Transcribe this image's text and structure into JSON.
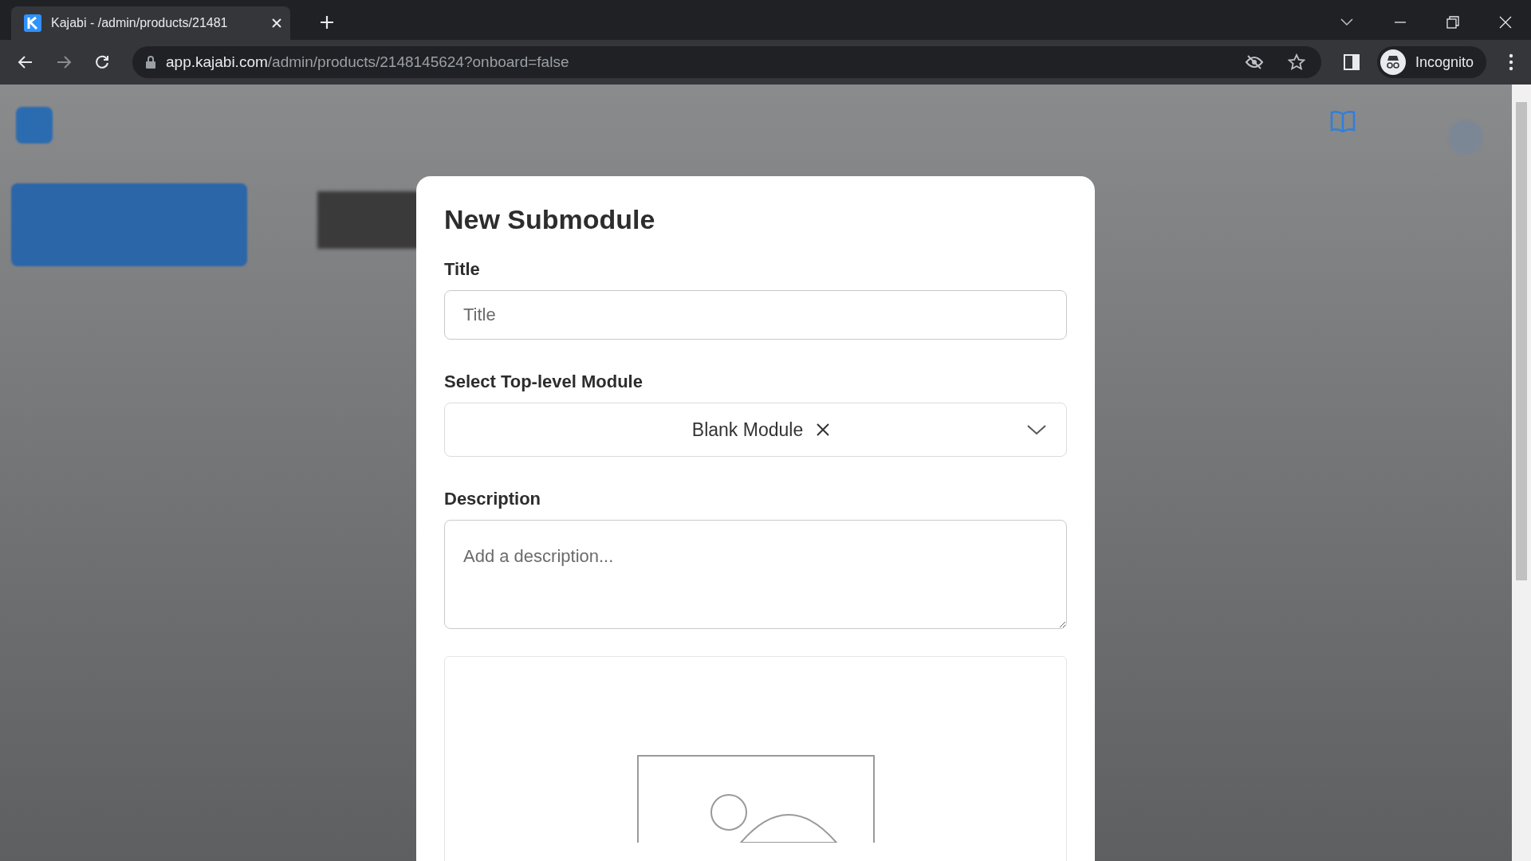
{
  "browser": {
    "tab_title": "Kajabi - /admin/products/21481",
    "url_host": "app.kajabi.com",
    "url_path": "/admin/products/2148145624?onboard=false",
    "profile": "Incognito"
  },
  "modal": {
    "title": "New Submodule",
    "fields": [
      {
        "kind": "input",
        "label": "Title",
        "placeholder": "Title"
      },
      {
        "kind": "select",
        "label": "Select Top-level Module",
        "value": "Blank Module"
      },
      {
        "kind": "textarea",
        "label": "Description",
        "placeholder": "Add a description..."
      }
    ]
  }
}
